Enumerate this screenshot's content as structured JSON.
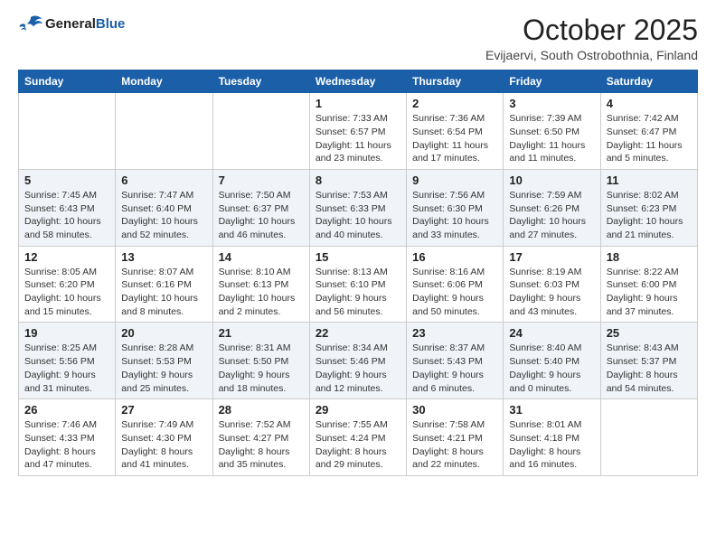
{
  "header": {
    "logo_line1": "General",
    "logo_line2": "Blue",
    "month": "October 2025",
    "location": "Evijaervi, South Ostrobothnia, Finland"
  },
  "weekdays": [
    "Sunday",
    "Monday",
    "Tuesday",
    "Wednesday",
    "Thursday",
    "Friday",
    "Saturday"
  ],
  "rows": [
    [
      {
        "num": "",
        "info": ""
      },
      {
        "num": "",
        "info": ""
      },
      {
        "num": "",
        "info": ""
      },
      {
        "num": "1",
        "info": "Sunrise: 7:33 AM\nSunset: 6:57 PM\nDaylight: 11 hours\nand 23 minutes."
      },
      {
        "num": "2",
        "info": "Sunrise: 7:36 AM\nSunset: 6:54 PM\nDaylight: 11 hours\nand 17 minutes."
      },
      {
        "num": "3",
        "info": "Sunrise: 7:39 AM\nSunset: 6:50 PM\nDaylight: 11 hours\nand 11 minutes."
      },
      {
        "num": "4",
        "info": "Sunrise: 7:42 AM\nSunset: 6:47 PM\nDaylight: 11 hours\nand 5 minutes."
      }
    ],
    [
      {
        "num": "5",
        "info": "Sunrise: 7:45 AM\nSunset: 6:43 PM\nDaylight: 10 hours\nand 58 minutes."
      },
      {
        "num": "6",
        "info": "Sunrise: 7:47 AM\nSunset: 6:40 PM\nDaylight: 10 hours\nand 52 minutes."
      },
      {
        "num": "7",
        "info": "Sunrise: 7:50 AM\nSunset: 6:37 PM\nDaylight: 10 hours\nand 46 minutes."
      },
      {
        "num": "8",
        "info": "Sunrise: 7:53 AM\nSunset: 6:33 PM\nDaylight: 10 hours\nand 40 minutes."
      },
      {
        "num": "9",
        "info": "Sunrise: 7:56 AM\nSunset: 6:30 PM\nDaylight: 10 hours\nand 33 minutes."
      },
      {
        "num": "10",
        "info": "Sunrise: 7:59 AM\nSunset: 6:26 PM\nDaylight: 10 hours\nand 27 minutes."
      },
      {
        "num": "11",
        "info": "Sunrise: 8:02 AM\nSunset: 6:23 PM\nDaylight: 10 hours\nand 21 minutes."
      }
    ],
    [
      {
        "num": "12",
        "info": "Sunrise: 8:05 AM\nSunset: 6:20 PM\nDaylight: 10 hours\nand 15 minutes."
      },
      {
        "num": "13",
        "info": "Sunrise: 8:07 AM\nSunset: 6:16 PM\nDaylight: 10 hours\nand 8 minutes."
      },
      {
        "num": "14",
        "info": "Sunrise: 8:10 AM\nSunset: 6:13 PM\nDaylight: 10 hours\nand 2 minutes."
      },
      {
        "num": "15",
        "info": "Sunrise: 8:13 AM\nSunset: 6:10 PM\nDaylight: 9 hours\nand 56 minutes."
      },
      {
        "num": "16",
        "info": "Sunrise: 8:16 AM\nSunset: 6:06 PM\nDaylight: 9 hours\nand 50 minutes."
      },
      {
        "num": "17",
        "info": "Sunrise: 8:19 AM\nSunset: 6:03 PM\nDaylight: 9 hours\nand 43 minutes."
      },
      {
        "num": "18",
        "info": "Sunrise: 8:22 AM\nSunset: 6:00 PM\nDaylight: 9 hours\nand 37 minutes."
      }
    ],
    [
      {
        "num": "19",
        "info": "Sunrise: 8:25 AM\nSunset: 5:56 PM\nDaylight: 9 hours\nand 31 minutes."
      },
      {
        "num": "20",
        "info": "Sunrise: 8:28 AM\nSunset: 5:53 PM\nDaylight: 9 hours\nand 25 minutes."
      },
      {
        "num": "21",
        "info": "Sunrise: 8:31 AM\nSunset: 5:50 PM\nDaylight: 9 hours\nand 18 minutes."
      },
      {
        "num": "22",
        "info": "Sunrise: 8:34 AM\nSunset: 5:46 PM\nDaylight: 9 hours\nand 12 minutes."
      },
      {
        "num": "23",
        "info": "Sunrise: 8:37 AM\nSunset: 5:43 PM\nDaylight: 9 hours\nand 6 minutes."
      },
      {
        "num": "24",
        "info": "Sunrise: 8:40 AM\nSunset: 5:40 PM\nDaylight: 9 hours\nand 0 minutes."
      },
      {
        "num": "25",
        "info": "Sunrise: 8:43 AM\nSunset: 5:37 PM\nDaylight: 8 hours\nand 54 minutes."
      }
    ],
    [
      {
        "num": "26",
        "info": "Sunrise: 7:46 AM\nSunset: 4:33 PM\nDaylight: 8 hours\nand 47 minutes."
      },
      {
        "num": "27",
        "info": "Sunrise: 7:49 AM\nSunset: 4:30 PM\nDaylight: 8 hours\nand 41 minutes."
      },
      {
        "num": "28",
        "info": "Sunrise: 7:52 AM\nSunset: 4:27 PM\nDaylight: 8 hours\nand 35 minutes."
      },
      {
        "num": "29",
        "info": "Sunrise: 7:55 AM\nSunset: 4:24 PM\nDaylight: 8 hours\nand 29 minutes."
      },
      {
        "num": "30",
        "info": "Sunrise: 7:58 AM\nSunset: 4:21 PM\nDaylight: 8 hours\nand 22 minutes."
      },
      {
        "num": "31",
        "info": "Sunrise: 8:01 AM\nSunset: 4:18 PM\nDaylight: 8 hours\nand 16 minutes."
      },
      {
        "num": "",
        "info": ""
      }
    ]
  ]
}
